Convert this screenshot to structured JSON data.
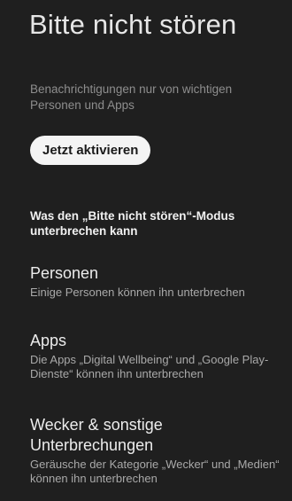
{
  "header": {
    "title": "Bitte nicht stören",
    "subtitle": "Benachrichtigungen nur von wichtigen Personen und Apps"
  },
  "actions": {
    "activate_label": "Jetzt aktivieren"
  },
  "interruptions": {
    "heading": "Was den „Bitte nicht stören“-Modus unterbrechen kann",
    "items": [
      {
        "title": "Personen",
        "summary": "Einige Personen können ihn unterbrechen"
      },
      {
        "title": "Apps",
        "summary": "Die Apps „Digital Wellbeing“ und „Google Play-Dienste“ können ihn unterbrechen"
      },
      {
        "title": "Wecker & sonstige Unterbrechungen",
        "summary": "Geräusche der Kategorie „Wecker“ und „Medien“ können ihn unterbrechen"
      }
    ]
  },
  "colors": {
    "background": "#1f1f1f",
    "button_background": "#f4f4f4",
    "button_text": "#1a1a1a",
    "secondary_text": "#a9a9a9"
  }
}
